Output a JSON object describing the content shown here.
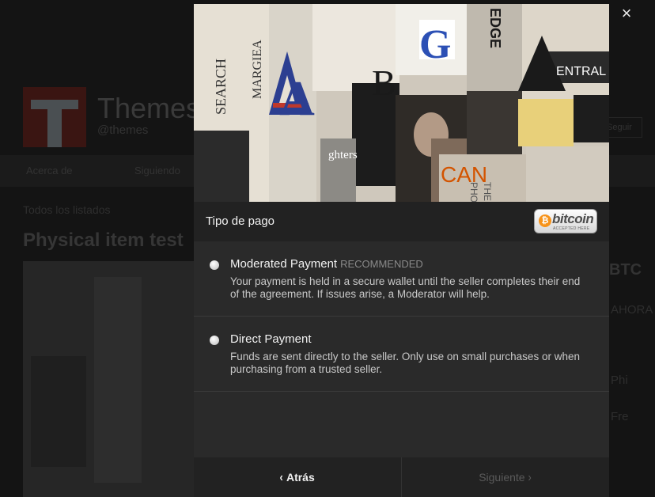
{
  "background": {
    "store_name": "Themes",
    "store_handle": "@themes",
    "follow_label": "Seguir",
    "nav": [
      "Acerca de",
      "Siguiendo"
    ],
    "breadcrumb": "Todos los listados",
    "listing_title": "Physical item test",
    "price": "BTC",
    "buy_label": "AHORA",
    "side_items": [
      "Phi",
      "Fre"
    ]
  },
  "modal": {
    "close_icon": "×",
    "header_title": "Tipo de pago",
    "bitcoin_badge": {
      "word": "bitcoin",
      "symbol": "₿",
      "subtitle": "ACCEPTED HERE"
    },
    "options": [
      {
        "title": "Moderated Payment",
        "badge": "RECOMMENDED",
        "description": "Your payment is held in a secure wallet until the seller completes their end of the agreement. If issues arise, a Moderator will help."
      },
      {
        "title": "Direct Payment",
        "badge": "",
        "description": "Funds are sent directly to the seller. Only use on small purchases or when purchasing from a trusted seller."
      }
    ],
    "back_label": "Atrás",
    "next_label": "Siguiente",
    "hero_text": [
      "SEARCH",
      "MARGIEA",
      "A",
      "G",
      "B",
      "EDGE",
      "ENTRAL",
      "CAN",
      "THE",
      "PHO",
      "ghters"
    ]
  },
  "colors": {
    "overlay_bg": "#141414",
    "modal_bg": "#2a2a2a",
    "bar_bg": "#222222",
    "bitcoin_orange": "#f7931a",
    "disabled_text": "#5a5a5a"
  }
}
